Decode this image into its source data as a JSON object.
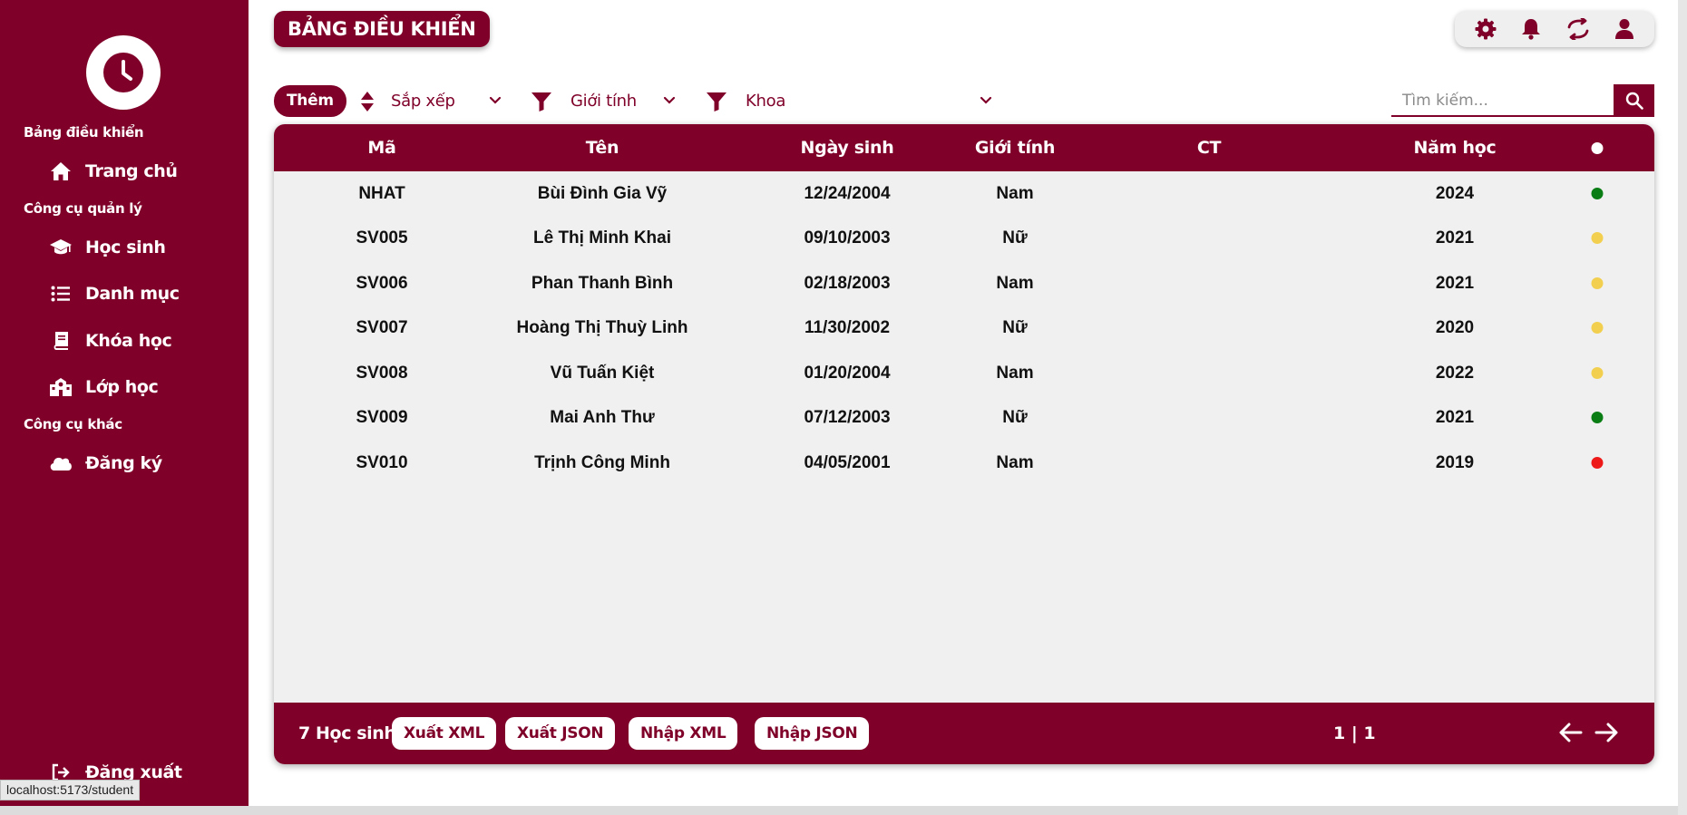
{
  "sidebar": {
    "sections": {
      "dashboard": "Bảng điều khiển",
      "management": "Công cụ quản lý",
      "other": "Công cụ khác"
    },
    "items": [
      {
        "label": "Trang chủ",
        "icon": "home-icon"
      },
      {
        "label": "Học sinh",
        "icon": "graduation-cap-icon"
      },
      {
        "label": "Danh mục",
        "icon": "list-icon"
      },
      {
        "label": "Khóa học",
        "icon": "book-icon"
      },
      {
        "label": "Lớp học",
        "icon": "school-icon"
      },
      {
        "label": "Đăng ký",
        "icon": "cloud-icon"
      }
    ],
    "logout": "Đăng xuất"
  },
  "status_url": "localhost:5173/student",
  "header": {
    "title": "BẢNG ĐIỀU KHIỂN",
    "icons": [
      "gear-icon",
      "bell-icon",
      "sync-icon",
      "user-icon"
    ]
  },
  "toolbar": {
    "add_label": "Thêm",
    "sort_label": "Sắp xếp",
    "gender_label": "Giới tính",
    "faculty_label": "Khoa",
    "search_placeholder": "Tìm kiếm..."
  },
  "table": {
    "columns": [
      "Mã",
      "Tên",
      "Ngày sinh",
      "Giới tính",
      "CT",
      "Năm học"
    ],
    "rows": [
      {
        "id": "NHAT",
        "name": "Bùi Đình Gia Vỹ",
        "dob": "12/24/2004",
        "gender": "Nam",
        "ct": "",
        "year": "2024",
        "status_color": "#0a7d14"
      },
      {
        "id": "SV005",
        "name": "Lê Thị Minh Khai",
        "dob": "09/10/2003",
        "gender": "Nữ",
        "ct": "",
        "year": "2021",
        "status_color": "#f2cf4f"
      },
      {
        "id": "SV006",
        "name": "Phan Thanh Bình",
        "dob": "02/18/2003",
        "gender": "Nam",
        "ct": "",
        "year": "2021",
        "status_color": "#f2cf4f"
      },
      {
        "id": "SV007",
        "name": "Hoàng Thị Thuỳ Linh",
        "dob": "11/30/2002",
        "gender": "Nữ",
        "ct": "",
        "year": "2020",
        "status_color": "#f2cf4f"
      },
      {
        "id": "SV008",
        "name": "Vũ Tuấn Kiệt",
        "dob": "01/20/2004",
        "gender": "Nam",
        "ct": "",
        "year": "2022",
        "status_color": "#f2cf4f"
      },
      {
        "id": "SV009",
        "name": "Mai Anh Thư",
        "dob": "07/12/2003",
        "gender": "Nữ",
        "ct": "",
        "year": "2021",
        "status_color": "#0a7d14"
      },
      {
        "id": "SV010",
        "name": "Trịnh Công Minh",
        "dob": "04/05/2001",
        "gender": "Nam",
        "ct": "",
        "year": "2019",
        "status_color": "#ee1a1a"
      }
    ]
  },
  "footer": {
    "count_label": "7 Học sinh",
    "export_xml": "Xuất XML",
    "export_json": "Xuất JSON",
    "import_xml": "Nhập XML",
    "import_json": "Nhập JSON",
    "page": "1 | 1"
  },
  "colors": {
    "brand": "#7f0029",
    "table_bg": "#f0f0f0",
    "status_green": "#0a7d14",
    "status_yellow": "#f2cf4f",
    "status_red": "#ee1a1a"
  }
}
